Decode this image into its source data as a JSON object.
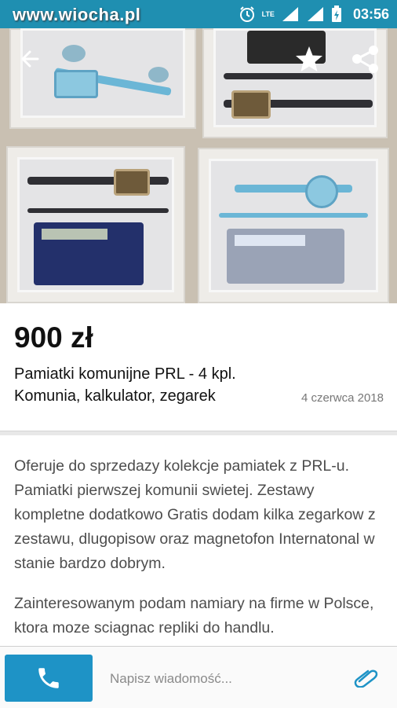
{
  "statusbar": {
    "watermark": "www.wiocha.pl",
    "network": "LTE",
    "time": "03:56",
    "icons": [
      "alarm-icon",
      "signal-icon",
      "battery-icon"
    ]
  },
  "header": {
    "icons": [
      "back-arrow-icon",
      "star-icon",
      "share-icon"
    ]
  },
  "listing": {
    "price": "900 zł",
    "title_line1": "Pamiatki komunijne PRL - 4 kpl.",
    "title_line2": "Komunia, kalkulator, zegarek",
    "date": "4 czerwca 2018",
    "description_p1": "Oferuje do sprzedazy kolekcje pamiatek z PRL-u. Pamiatki pierwszej komunii swietej. Zestawy kompletne dodatkowo Gratis dodam kilka zegarkow z zestawu, dlugopisow oraz magnetofon Internatonal w stanie bardzo dobrym.",
    "description_p2": "Zainteresowanym podam namiary na firme w Polsce, ktora moze sciagnac repliki do handlu."
  },
  "bottombar": {
    "message_placeholder": "Napisz wiadomość...",
    "icons": [
      "phone-icon",
      "paperclip-icon"
    ]
  },
  "colors": {
    "accent": "#1e93c6",
    "statusbar": "#1f8fb1"
  }
}
